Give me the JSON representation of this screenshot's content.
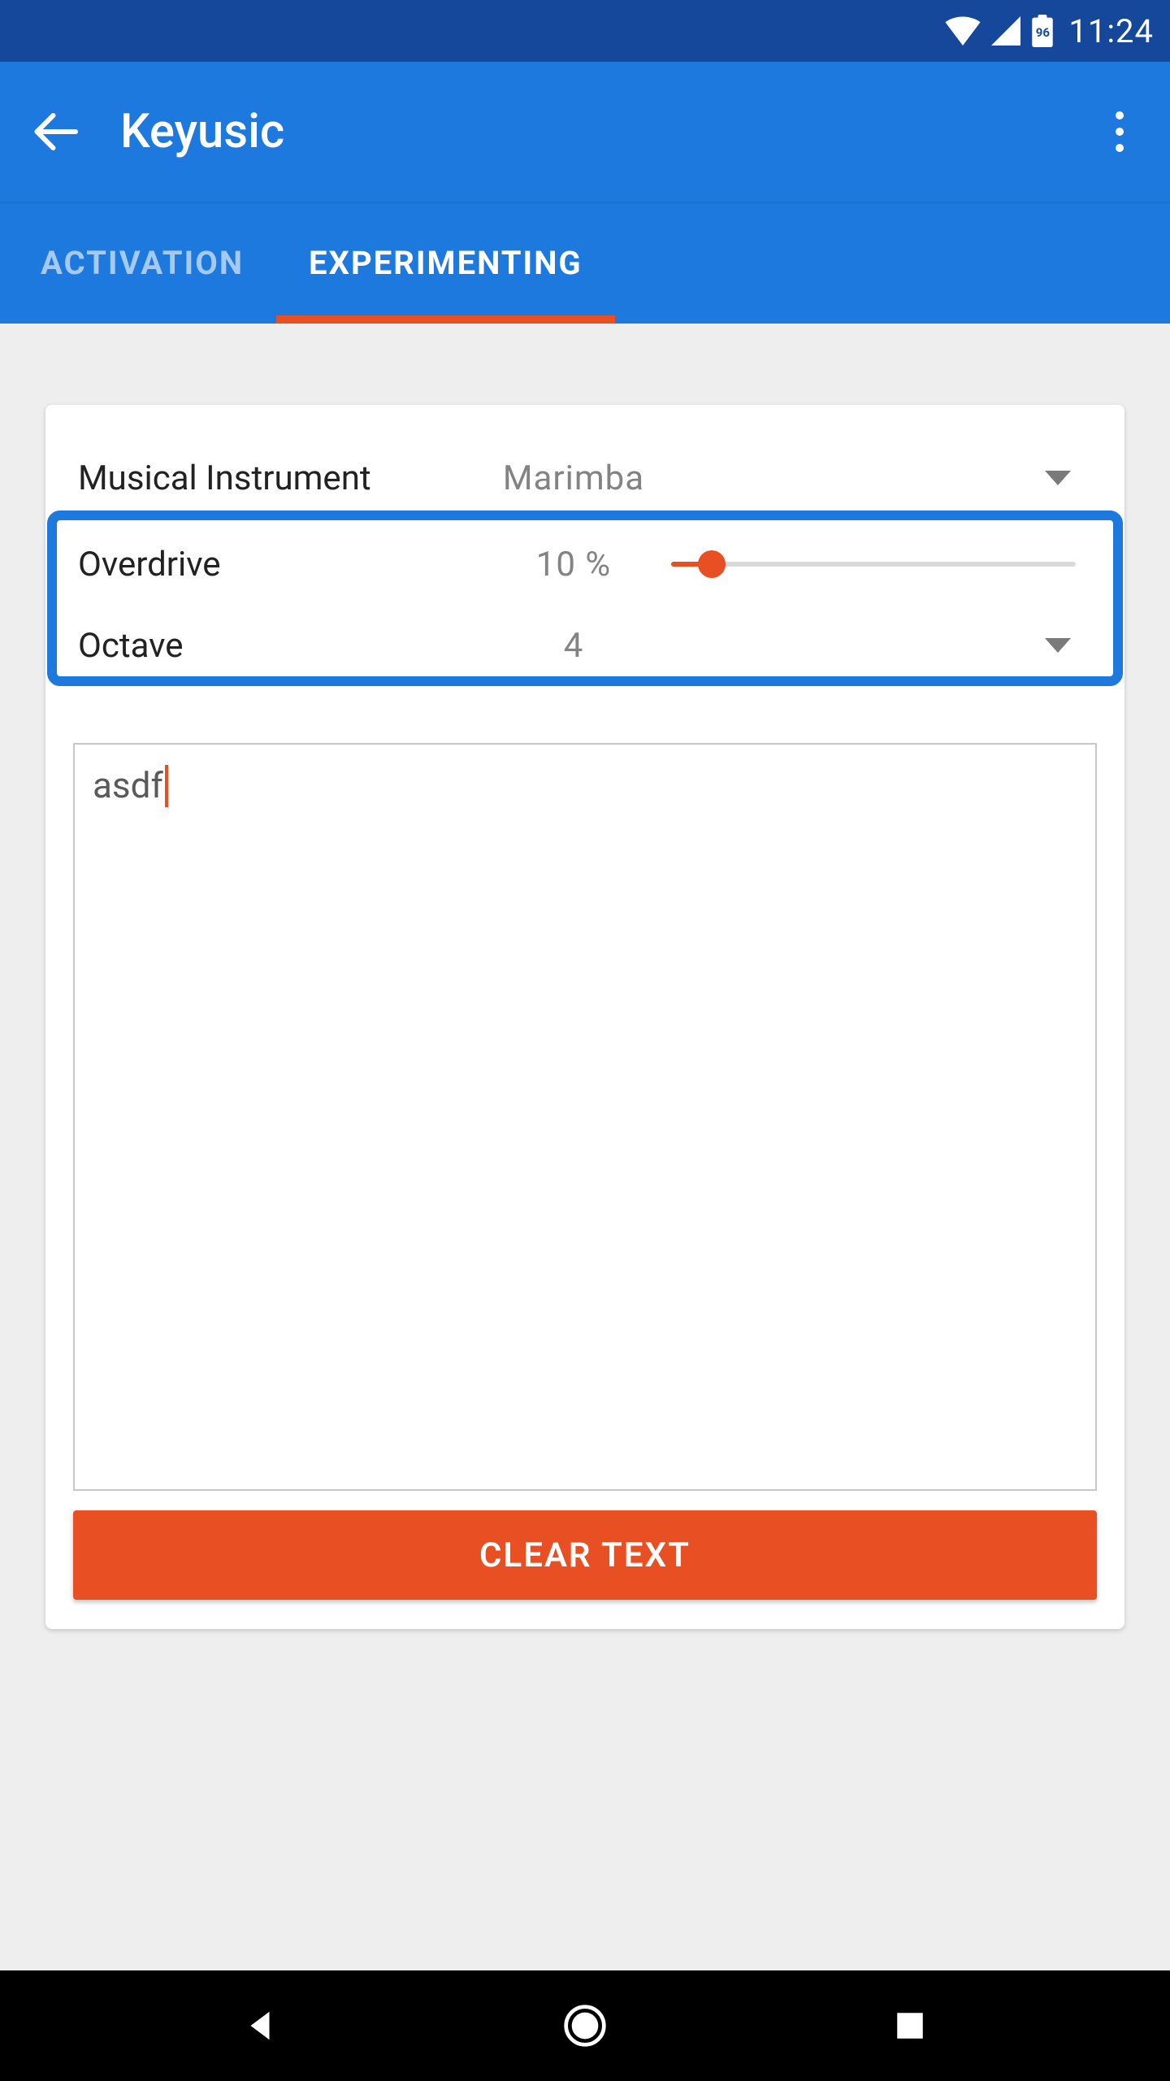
{
  "status": {
    "battery_level": "96",
    "time": "11:24"
  },
  "appbar": {
    "title": "Keyusic"
  },
  "tabs": {
    "activation": "ACTIVATION",
    "experimenting": "EXPERIMENTING",
    "active_index": 1
  },
  "settings": {
    "instrument_label": "Musical Instrument",
    "instrument_value": "Marimba",
    "overdrive_label": "Overdrive",
    "overdrive_value": "10 %",
    "overdrive_percent": 10,
    "octave_label": "Octave",
    "octave_value": "4"
  },
  "editor": {
    "text": "asdf"
  },
  "buttons": {
    "clear": "CLEAR TEXT"
  },
  "colors": {
    "primary": "#1d79de",
    "primary_dark": "#15489a",
    "accent": "#e85023",
    "bg": "#eeeeee"
  }
}
